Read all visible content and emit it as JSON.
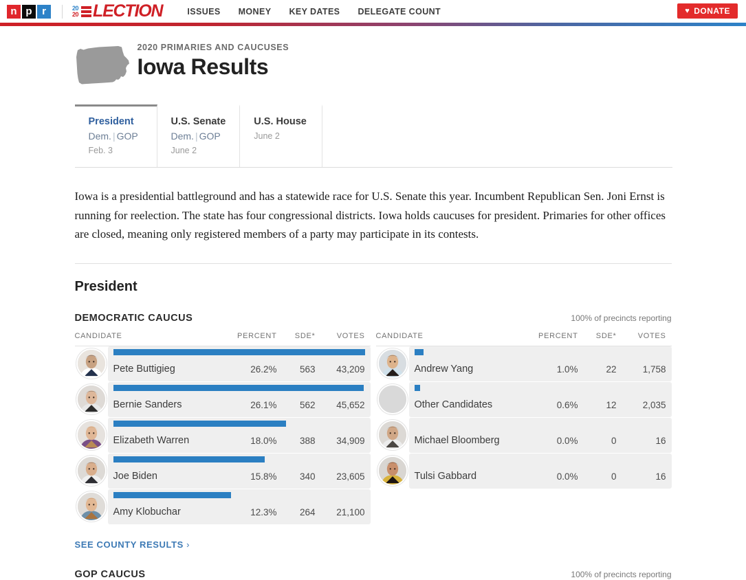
{
  "nav": {
    "brand": "npr",
    "brand_letters": [
      "n",
      "p",
      "r"
    ],
    "election_year_top": "20",
    "election_year_bottom": "20",
    "election_word": "LECTION",
    "links": [
      {
        "label": "ISSUES"
      },
      {
        "label": "MONEY"
      },
      {
        "label": "KEY DATES"
      },
      {
        "label": "DELEGATE COUNT"
      }
    ],
    "donate_label": "DONATE",
    "heart_glyph": "♥"
  },
  "hero": {
    "kicker": "2020 PRIMARIES AND CAUCUSES",
    "title": "Iowa Results",
    "state_icon": "iowa-state-shape"
  },
  "tabs": [
    {
      "name": "President",
      "parties_dem": "Dem.",
      "parties_sep": "|",
      "parties_gop": "GOP",
      "date": "Feb. 3",
      "active": true
    },
    {
      "name": "U.S. Senate",
      "parties_dem": "Dem.",
      "parties_sep": "|",
      "parties_gop": "GOP",
      "date": "June 2",
      "active": false
    },
    {
      "name": "U.S. House",
      "parties_dem": "",
      "parties_sep": "",
      "parties_gop": "",
      "date": "June 2",
      "active": false
    }
  ],
  "description": "Iowa is a presidential battleground and has a statewide race for U.S. Senate this year. Incumbent Republican Sen. Joni Ernst is running for reelection. The state has four congressional districts. Iowa holds caucuses for president. Primaries for other offices are closed, meaning only registered members of a party may participate in its contests.",
  "section_title": "President",
  "dem_race": {
    "name": "DEMOCRATIC CAUCUS",
    "reporting": "100% of precincts reporting"
  },
  "gop_race": {
    "name": "GOP CAUCUS",
    "reporting": "100% of precincts reporting"
  },
  "columns": {
    "candidate": "CANDIDATE",
    "percent": "PERCENT",
    "sde": "SDE*",
    "votes": "VOTES"
  },
  "county_link": "SEE COUNTY RESULTS",
  "county_link_chevron": "›",
  "colors": {
    "bar_blue": "#2b7fc2",
    "row_bg": "#efefef",
    "link_blue": "#3d7ab5",
    "active_tab_blue": "#2f5f9e",
    "donate_red": "#e32b2b",
    "npr_red": "#e0262c",
    "npr_blue": "#2d82c8",
    "election_red": "#cf2026",
    "state_gray": "#9a9a9a"
  },
  "chart_data": {
    "type": "bar",
    "title": "DEMOCRATIC CAUCUS — Iowa 2020 Presidential Caucus Results",
    "xlabel": "",
    "ylabel": "",
    "grid": false,
    "legend": "none",
    "bar_color": "#2b7fc2",
    "columns": [
      "CANDIDATE",
      "PERCENT",
      "SDE*",
      "VOTES"
    ],
    "categories": [
      "Pete Buttigieg",
      "Bernie Sanders",
      "Elizabeth Warren",
      "Joe Biden",
      "Amy Klobuchar",
      "Andrew Yang",
      "Other Candidates",
      "Michael Bloomberg",
      "Tulsi Gabbard"
    ],
    "values": [
      26.2,
      26.1,
      18.0,
      15.8,
      12.3,
      1.0,
      0.6,
      0.0,
      0.0
    ],
    "ylim": [
      0,
      26.2
    ],
    "rows_left": [
      {
        "name": "Pete Buttigieg",
        "percent": "26.2%",
        "sde": "563",
        "votes": "43,209",
        "bar": 26.2,
        "avatar": "pete-buttigieg-photo"
      },
      {
        "name": "Bernie Sanders",
        "percent": "26.1%",
        "sde": "562",
        "votes": "45,652",
        "bar": 26.1,
        "avatar": "bernie-sanders-photo"
      },
      {
        "name": "Elizabeth Warren",
        "percent": "18.0%",
        "sde": "388",
        "votes": "34,909",
        "bar": 18.0,
        "avatar": "elizabeth-warren-photo"
      },
      {
        "name": "Joe Biden",
        "percent": "15.8%",
        "sde": "340",
        "votes": "23,605",
        "bar": 15.8,
        "avatar": "joe-biden-photo"
      },
      {
        "name": "Amy Klobuchar",
        "percent": "12.3%",
        "sde": "264",
        "votes": "21,100",
        "bar": 12.3,
        "avatar": "amy-klobuchar-photo"
      }
    ],
    "rows_right": [
      {
        "name": "Andrew Yang",
        "percent": "1.0%",
        "sde": "22",
        "votes": "1,758",
        "bar": 1.0,
        "avatar": "andrew-yang-photo"
      },
      {
        "name": "Other Candidates",
        "percent": "0.6%",
        "sde": "12",
        "votes": "2,035",
        "bar": 0.6,
        "avatar": "placeholder-avatar"
      },
      {
        "name": "Michael Bloomberg",
        "percent": "0.0%",
        "sde": "0",
        "votes": "16",
        "bar": 0.0,
        "avatar": "michael-bloomberg-photo"
      },
      {
        "name": "Tulsi Gabbard",
        "percent": "0.0%",
        "sde": "0",
        "votes": "16",
        "bar": 0.0,
        "avatar": "tulsi-gabbard-photo"
      }
    ]
  }
}
